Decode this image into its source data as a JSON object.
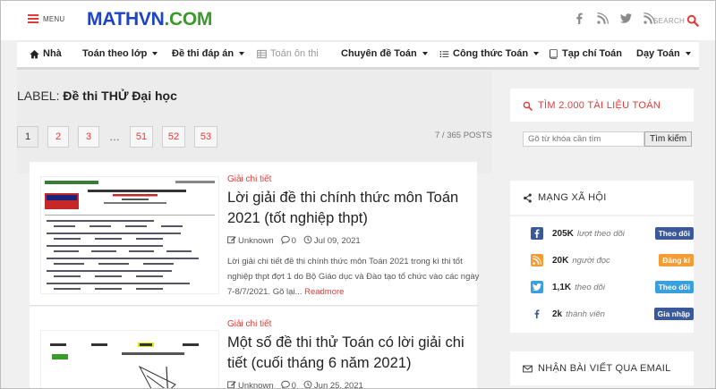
{
  "header": {
    "menu_label": "MENU",
    "logo_part1": "MATHVN",
    "logo_part2": ".COM",
    "search_label": "SEARCH"
  },
  "nav": {
    "items": [
      {
        "label": "Nhà",
        "icon": "home-icon",
        "dropdown": false
      },
      {
        "label": "Toán theo lớp",
        "dropdown": true
      },
      {
        "label": "Đề thi đáp án",
        "dropdown": true
      },
      {
        "label": "Toán ôn thi",
        "icon": "table-icon",
        "dropdown": false
      },
      {
        "label": "Chuyên đề Toán",
        "dropdown": true
      },
      {
        "label": "Công thức Toán",
        "icon": "list-icon",
        "dropdown": true
      },
      {
        "label": "Tạp chí Toán",
        "icon": "book-icon",
        "dropdown": false
      },
      {
        "label": "Dạy Toán",
        "dropdown": true
      }
    ]
  },
  "main": {
    "label_prefix": "LABEL:",
    "label_name": "Đề thi THỬ Đại học",
    "pages": [
      "1",
      "2",
      "3",
      "…",
      "51",
      "52",
      "53"
    ],
    "posts_count": "7 / 365 POSTS",
    "articles": [
      {
        "category": "Giải chi tiết",
        "title": "Lời giải đề thi chính thức môn Toán 2021 (tốt nghiệp thpt)",
        "author": "Unknown",
        "comments": "0",
        "date": "Jul 09, 2021",
        "excerpt": "Lời giải chi tiết đề thi chính thức môn Toán 2021 trong kì thi tốt nghiệp thpt đợt 1 do Bộ Giáo dục và Đào tạo tổ chức vào các ngày 7-8/7/2021. Gõ lại...",
        "read_more": "Readmore"
      },
      {
        "category": "Giải chi tiết",
        "title": "Một số đề thi thử Toán có lời giải chi tiết (cuối tháng 6 năm 2021)",
        "author": "Unknown",
        "comments": "0",
        "date": "Jun 25, 2021"
      }
    ]
  },
  "sidebar": {
    "search_title": "TÌM 2.000 TÀI LIỆU TOÁN",
    "search_placeholder": "Gõ từ khóa cần tìm",
    "search_button": "Tìm kiếm",
    "social_title": "MẠNG XÃ HỘI",
    "social": [
      {
        "icon": "facebook-icon",
        "count": "205K",
        "desc": "lượt theo dõi",
        "button": "Theo dõi",
        "color": "#3b5998",
        "btn_color": "#3b5998"
      },
      {
        "icon": "rss-icon",
        "count": "20K",
        "desc": "người đọc",
        "button": "Đăng kí",
        "color": "#f39c33",
        "btn_color": "#f39c33"
      },
      {
        "icon": "twitter-icon",
        "count": "1,1K",
        "desc": "theo dõi",
        "button": "Theo dõi",
        "color": "#3aa0dd",
        "btn_color": "#3aa0dd"
      },
      {
        "icon": "facebook-icon",
        "count": "2k",
        "desc": "thành viên",
        "button": "Gia nhập",
        "color": "#3b5998",
        "btn_color": "#3b5998"
      }
    ],
    "email_title": "NHẬN BÀI VIẾT QUA EMAIL"
  },
  "colors": {
    "accent": "#e53935",
    "logo_blue": "#1d43c7",
    "logo_green": "#3a9a2c"
  }
}
